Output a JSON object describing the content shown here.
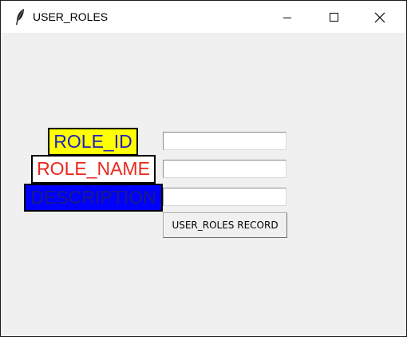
{
  "window": {
    "title": "USER_ROLES",
    "icon": "feather-icon",
    "controls": [
      "minimize-icon",
      "maximize-icon",
      "close-icon"
    ]
  },
  "form": {
    "labels": {
      "role_id": "ROLE_ID",
      "role_name": "ROLE_NAME",
      "description": "DESCRIPTION"
    },
    "label_colors": {
      "role_id": {
        "background": "#ffff00",
        "text": "#2020c0"
      },
      "role_name": {
        "background": "#ffffff",
        "text": "#e8281c"
      },
      "description": {
        "background": "#0000ff",
        "text": "#1a1a80"
      }
    },
    "fields": {
      "role_id": "",
      "role_name": "",
      "description": ""
    },
    "submit_label": "USER_ROLES RECORD"
  }
}
